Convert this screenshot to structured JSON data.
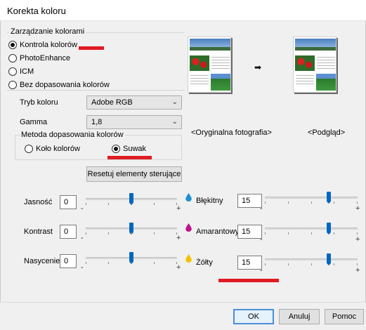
{
  "window": {
    "title": "Korekta koloru"
  },
  "color_management": {
    "group_label": "Zarządzanie kolorami",
    "options": [
      {
        "label": "Kontrola kolorów",
        "selected": true
      },
      {
        "label": "PhotoEnhance",
        "selected": false
      },
      {
        "label": "ICM",
        "selected": false
      },
      {
        "label": "Bez dopasowania kolorów",
        "selected": false
      }
    ]
  },
  "color_mode": {
    "label": "Tryb koloru",
    "value": "Adobe RGB"
  },
  "gamma": {
    "label": "Gamma",
    "value": "1,8"
  },
  "matching_method": {
    "group_label": "Metoda dopasowania kolorów",
    "options": [
      {
        "label": "Koło kolorów",
        "selected": false
      },
      {
        "label": "Suwak",
        "selected": true
      }
    ]
  },
  "reset_button": "Resetuj elementy sterujące",
  "preview": {
    "original_label": "<Oryginalna fotografia>",
    "preview_label": "<Podgląd>",
    "arrow": "➡"
  },
  "adjustments_left": [
    {
      "label": "Jasność",
      "value": "0",
      "level": 0.5
    },
    {
      "label": "Kontrast",
      "value": "0",
      "level": 0.5
    },
    {
      "label": "Nasycenie",
      "value": "0",
      "level": 0.5
    }
  ],
  "adjustments_right": [
    {
      "label": "Błękitny",
      "value": "15",
      "level": 0.7,
      "icon": "cyan-drop-icon",
      "color": "#1e90d6"
    },
    {
      "label": "Amarantowy",
      "value": "15",
      "level": 0.7,
      "icon": "magenta-drop-icon",
      "color": "#c0138c"
    },
    {
      "label": "Żółty",
      "value": "15",
      "level": 0.7,
      "icon": "yellow-drop-icon",
      "color": "#f2c200"
    }
  ],
  "slider_signs": {
    "minus": "-",
    "plus": "+"
  },
  "buttons": {
    "ok": "OK",
    "cancel": "Anuluj",
    "help": "Pomoc"
  },
  "colors": {
    "thumb": "#0067c0",
    "annotation": "#e01b24"
  }
}
